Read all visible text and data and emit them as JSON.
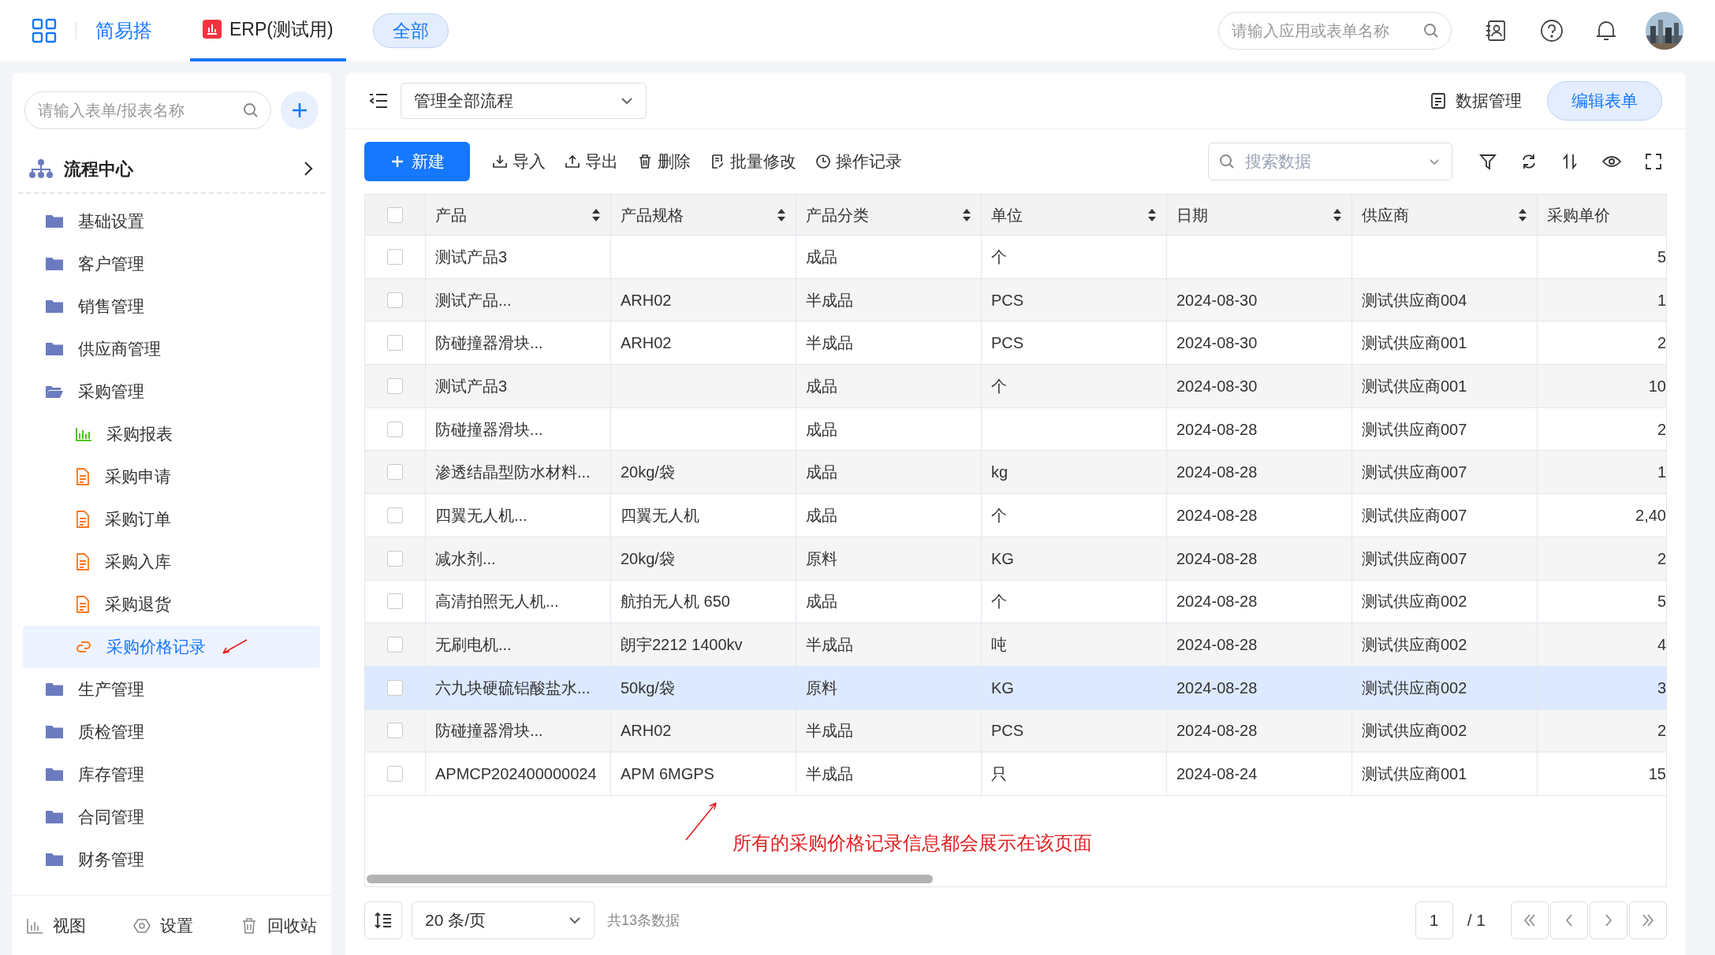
{
  "top_bar": {
    "app_name": "简易搭",
    "tabs": [
      {
        "label": "ERP(测试用)",
        "selected": true
      }
    ],
    "scope_button": {
      "label": "全部",
      "selected": true
    },
    "search": {
      "placeholder": "请输入应用或表单名称"
    }
  },
  "sidebar": {
    "search": {
      "placeholder": "请输入表单/报表名称"
    },
    "section_title": "流程中心",
    "items": [
      {
        "label": "基础设置",
        "expanded": false
      },
      {
        "label": "客户管理",
        "expanded": false
      },
      {
        "label": "销售管理",
        "expanded": false
      },
      {
        "label": "供应商管理",
        "expanded": false
      },
      {
        "label": "采购管理",
        "expanded": true,
        "children": [
          {
            "label": "采购报表",
            "kind": "report",
            "selected": false
          },
          {
            "label": "采购申请",
            "kind": "form",
            "selected": false
          },
          {
            "label": "采购订单",
            "kind": "form",
            "selected": false
          },
          {
            "label": "采购入库",
            "kind": "form",
            "selected": false
          },
          {
            "label": "采购退货",
            "kind": "form",
            "selected": false
          },
          {
            "label": "采购价格记录",
            "kind": "link",
            "selected": true
          }
        ]
      },
      {
        "label": "生产管理",
        "expanded": false
      },
      {
        "label": "质检管理",
        "expanded": false
      },
      {
        "label": "库存管理",
        "expanded": false
      },
      {
        "label": "合同管理",
        "expanded": false
      },
      {
        "label": "财务管理",
        "expanded": false
      }
    ],
    "footer": [
      {
        "label": "视图",
        "kind": "view"
      },
      {
        "label": "设置",
        "kind": "settings"
      },
      {
        "label": "回收站",
        "kind": "trash"
      }
    ]
  },
  "main": {
    "flow_select": "管理全部流程",
    "data_manage": "数据管理",
    "edit_form": "编辑表单",
    "toolbar": [
      {
        "label": "新建",
        "kind": "primary"
      },
      {
        "label": "导入",
        "kind": "import"
      },
      {
        "label": "导出",
        "kind": "export"
      },
      {
        "label": "删除",
        "kind": "delete"
      },
      {
        "label": "批量修改",
        "kind": "edit"
      },
      {
        "label": "操作记录",
        "kind": "history"
      }
    ],
    "search": {
      "placeholder": "搜索数据"
    },
    "table": {
      "select_all": false,
      "columns": [
        {
          "label": "产品",
          "sortable": true
        },
        {
          "label": "产品规格",
          "sortable": true
        },
        {
          "label": "产品分类",
          "sortable": true
        },
        {
          "label": "单位",
          "sortable": true
        },
        {
          "label": "日期",
          "sortable": true
        },
        {
          "label": "供应商",
          "sortable": true
        },
        {
          "label": "采购单价",
          "sortable": false
        }
      ],
      "rows": [
        {
          "checked": false,
          "highlighted": false,
          "cells": {
            "product": "测试产品3",
            "category": "成品",
            "unit": "个",
            "price": "5"
          }
        },
        {
          "checked": false,
          "highlighted": false,
          "cells": {
            "product": "测试产品...",
            "spec": "ARH02",
            "category": "半成品",
            "unit": "PCS",
            "date": "2024-08-30",
            "supplier": "测试供应商004",
            "price": "1"
          }
        },
        {
          "checked": false,
          "highlighted": false,
          "cells": {
            "product": "防碰撞器滑块...",
            "spec": "ARH02",
            "category": "半成品",
            "unit": "PCS",
            "date": "2024-08-30",
            "supplier": "测试供应商001",
            "price": "2"
          }
        },
        {
          "checked": false,
          "highlighted": false,
          "cells": {
            "product": "测试产品3",
            "category": "成品",
            "unit": "个",
            "date": "2024-08-30",
            "supplier": "测试供应商001",
            "price": "10"
          }
        },
        {
          "checked": false,
          "highlighted": false,
          "cells": {
            "product": "防碰撞器滑块...",
            "category": "成品",
            "date": "2024-08-28",
            "supplier": "测试供应商007",
            "price": "2"
          }
        },
        {
          "checked": false,
          "highlighted": false,
          "cells": {
            "product": "渗透结晶型防水材料...",
            "spec": "20kg/袋",
            "category": "成品",
            "unit": "kg",
            "date": "2024-08-28",
            "supplier": "测试供应商007",
            "price": "1"
          }
        },
        {
          "checked": false,
          "highlighted": false,
          "cells": {
            "product": "四翼无人机...",
            "spec": "四翼无人机",
            "category": "成品",
            "unit": "个",
            "date": "2024-08-28",
            "supplier": "测试供应商007",
            "price": "2,40"
          }
        },
        {
          "checked": false,
          "highlighted": false,
          "cells": {
            "product": "减水剂...",
            "spec": "20kg/袋",
            "category": "原料",
            "unit": "KG",
            "date": "2024-08-28",
            "supplier": "测试供应商007",
            "price": "2"
          }
        },
        {
          "checked": false,
          "highlighted": false,
          "cells": {
            "product": "高清拍照无人机...",
            "spec": "航拍无人机 650",
            "category": "成品",
            "unit": "个",
            "date": "2024-08-28",
            "supplier": "测试供应商002",
            "price": "5"
          }
        },
        {
          "checked": false,
          "highlighted": false,
          "cells": {
            "product": "无刷电机...",
            "spec": "朗宇2212  1400kv",
            "category": "半成品",
            "unit": "吨",
            "date": "2024-08-28",
            "supplier": "测试供应商002",
            "price": "4"
          }
        },
        {
          "checked": false,
          "highlighted": true,
          "cells": {
            "product": "六九块硬硫铝酸盐水...",
            "spec": "50kg/袋",
            "category": "原料",
            "unit": "KG",
            "date": "2024-08-28",
            "supplier": "测试供应商002",
            "price": "3"
          }
        },
        {
          "checked": false,
          "highlighted": false,
          "cells": {
            "product": "防碰撞器滑块...",
            "spec": "ARH02",
            "category": "半成品",
            "unit": "PCS",
            "date": "2024-08-28",
            "supplier": "测试供应商002",
            "price": "2"
          }
        },
        {
          "checked": false,
          "highlighted": false,
          "cells": {
            "product": "APMCP202400000024",
            "spec": "APM 6MGPS",
            "category": "半成品",
            "unit": "只",
            "date": "2024-08-24",
            "supplier": "测试供应商001",
            "price": "15"
          }
        }
      ]
    },
    "annotation": "所有的采购价格记录信息都会展示在该页面",
    "pagination": {
      "page_size": "20 条/页",
      "total": "共13条数据",
      "page": "1",
      "page_total": "/ 1"
    }
  }
}
